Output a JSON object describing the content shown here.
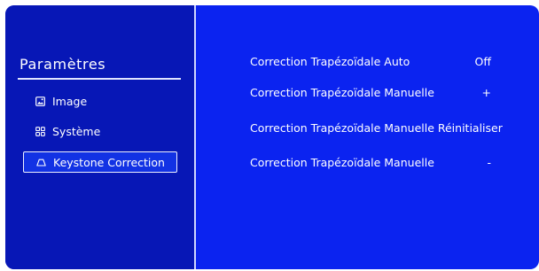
{
  "sidebar": {
    "title": "Paramètres",
    "items": [
      {
        "label": "Image",
        "icon": "image-icon",
        "active": false
      },
      {
        "label": "Système",
        "icon": "grid-icon",
        "active": false
      },
      {
        "label": "Keystone Correction",
        "icon": "trapezoid-icon",
        "active": true
      }
    ]
  },
  "settings": [
    {
      "label": "Correction Trapézoïdale Auto",
      "value": "Off"
    },
    {
      "label": "Correction Trapézoïdale Manuelle",
      "value": "+"
    },
    {
      "label": "Correction Trapézoïdale Manuelle Réinitialiser",
      "value": ""
    },
    {
      "label": "Correction Trapézoïdale Manuelle",
      "value": "-"
    }
  ],
  "colors": {
    "background": "#0b23f0",
    "sidebar": "#0717b6",
    "text": "#ffffff"
  }
}
